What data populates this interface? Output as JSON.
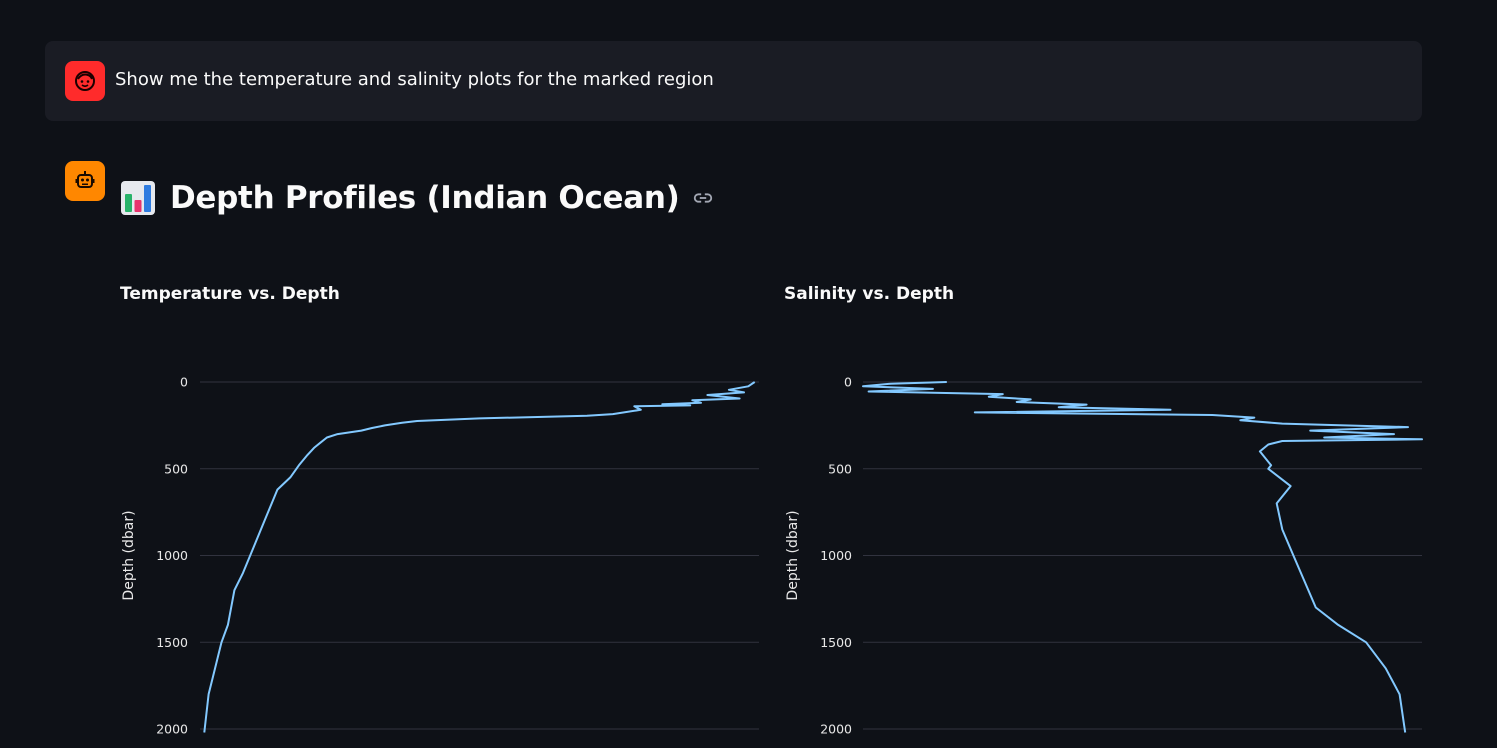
{
  "user_message": {
    "text": "Show me the temperature and salinity plots for the marked region",
    "avatar_icon": "user-face-icon"
  },
  "assistant": {
    "avatar_icon": "robot-icon",
    "heading_icon": "bar-chart-emoji",
    "heading": "Depth Profiles (Indian Ocean)",
    "link_icon": "link-icon"
  },
  "colors": {
    "background": "#0e1117",
    "message_bg": "#1a1c24",
    "user_avatar": "#ff2b2b",
    "bot_avatar": "#ff8700",
    "series_line": "#83c9ff",
    "gridline": "#31333f"
  },
  "chart_data": [
    {
      "type": "line",
      "title": "Temperature vs. Depth",
      "xlabel": "",
      "ylabel": "Depth (dbar)",
      "y_reversed": true,
      "ylim": [
        0,
        2000
      ],
      "yticks": [
        0,
        500,
        1000,
        1500,
        2000
      ],
      "xlim": [
        3,
        29
      ],
      "grid": true,
      "series": [
        {
          "x": [
            28.8,
            28.5,
            27.6,
            28.3,
            26.6,
            28.1,
            25.9,
            26.3,
            24.5,
            25.8,
            23.2,
            23.5,
            22.2,
            21.0,
            16.0,
            13.1,
            12.4,
            11.6,
            11.0,
            10.5,
            9.4,
            8.9,
            8.6,
            8.3,
            8.0,
            7.6,
            7.2,
            6.6,
            6.0,
            5.5,
            5.0,
            4.6,
            4.3,
            4.0,
            3.8,
            3.6,
            3.4,
            3.2
          ],
          "y": [
            0,
            25,
            45,
            60,
            75,
            95,
            105,
            120,
            128,
            135,
            140,
            160,
            185,
            195,
            210,
            225,
            235,
            250,
            265,
            280,
            300,
            320,
            350,
            380,
            420,
            480,
            550,
            620,
            800,
            950,
            1100,
            1200,
            1400,
            1500,
            1600,
            1700,
            1800,
            2020
          ]
        }
      ]
    },
    {
      "type": "line",
      "title": "Salinity vs. Depth",
      "xlabel": "",
      "ylabel": "Depth (dbar)",
      "y_reversed": true,
      "ylim": [
        0,
        2000
      ],
      "yticks": [
        0,
        500,
        1000,
        1500,
        2000
      ],
      "xlim": [
        33.5,
        35.5
      ],
      "grid": true,
      "series": [
        {
          "x": [
            33.8,
            33.6,
            33.5,
            33.75,
            33.52,
            34.0,
            33.95,
            34.1,
            34.05,
            34.3,
            34.2,
            34.6,
            33.9,
            34.75,
            34.9,
            34.85,
            35.0,
            35.45,
            35.1,
            35.4,
            35.15,
            35.5,
            35.0,
            34.95,
            34.92,
            34.96,
            34.95,
            35.03,
            34.98,
            35.0,
            35.04,
            35.08,
            35.12,
            35.2,
            35.3,
            35.37,
            35.42,
            35.44
          ],
          "y": [
            0,
            10,
            25,
            40,
            55,
            70,
            85,
            100,
            115,
            130,
            145,
            160,
            175,
            190,
            205,
            220,
            240,
            260,
            280,
            300,
            320,
            330,
            340,
            360,
            400,
            480,
            500,
            600,
            700,
            850,
            1000,
            1150,
            1300,
            1400,
            1500,
            1650,
            1800,
            2020
          ]
        }
      ]
    }
  ]
}
